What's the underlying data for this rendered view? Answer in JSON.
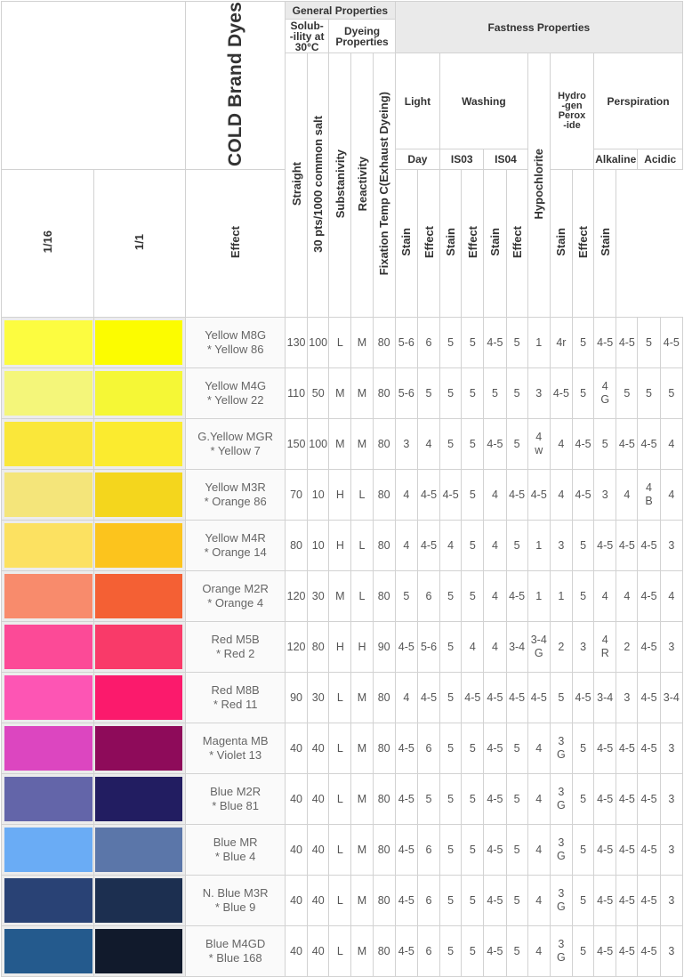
{
  "header": {
    "title": "COLD Brand Dyes",
    "general": "General Properties",
    "solubility": "Solub--ility at 30°C",
    "dyeing": "Dyeing Properties",
    "fastness": "Fastness Properties",
    "light": "Light",
    "day": "Day",
    "washing": "Washing",
    "iso3": "IS03",
    "iso4": "IS04",
    "hydrogen": "Hydro -gen Perox -ide",
    "perspiration": "Perspiration",
    "alkaline": "Alkaline",
    "acidic": "Acidic",
    "cols": {
      "straight": "Straight",
      "salt": "30 pts/1000 common salt",
      "substanivity": "Substanivity",
      "reactivity": "Reactivity",
      "fixation": "Fixation Temp C(Exhaust Dyeing)",
      "l116": "1/16",
      "l11": "1/1",
      "effect": "Effect",
      "stain": "Stain",
      "hypochlorite": "Hypochlorite"
    }
  },
  "colors": {
    "border": "#d2d2d2",
    "header_bg": "#eaeaea"
  },
  "rows": [
    {
      "name": "Yellow M8G",
      "ci": "* Yellow 86",
      "c1": "#fcfc40",
      "c2": "#fcfc00",
      "v": [
        "130",
        "100",
        "L",
        "M",
        "80",
        "5-6",
        "6",
        "5",
        "5",
        "4-5",
        "5",
        "1",
        "4r",
        "5",
        "4-5",
        "4-5",
        "5",
        "4-5"
      ]
    },
    {
      "name": "Yellow M4G",
      "ci": "* Yellow 22",
      "c1": "#f4f67a",
      "c2": "#f5f736",
      "v": [
        "110",
        "50",
        "M",
        "M",
        "80",
        "5-6",
        "5",
        "5",
        "5",
        "5",
        "5",
        "3",
        "4-5",
        "5",
        "4 G",
        "5",
        "5",
        "5"
      ]
    },
    {
      "name": "G.Yellow MGR",
      "ci": "* Yellow 7",
      "c1": "#fae73a",
      "c2": "#fbeb2f",
      "v": [
        "150",
        "100",
        "M",
        "M",
        "80",
        "3",
        "4",
        "5",
        "5",
        "4-5",
        "5",
        "4 w",
        "4",
        "4-5",
        "5",
        "4-5",
        "4-5",
        "4"
      ]
    },
    {
      "name": "Yellow M3R",
      "ci": "* Orange 86",
      "c1": "#f4e57a",
      "c2": "#f4d61d",
      "v": [
        "70",
        "10",
        "H",
        "L",
        "80",
        "4",
        "4-5",
        "4-5",
        "5",
        "4",
        "4-5",
        "4-5",
        "4",
        "4-5",
        "3",
        "4",
        "4 B",
        "4"
      ]
    },
    {
      "name": "Yellow M4R",
      "ci": "* Orange 14",
      "c1": "#fce161",
      "c2": "#fcc41d",
      "v": [
        "80",
        "10",
        "H",
        "L",
        "80",
        "4",
        "4-5",
        "4",
        "5",
        "4",
        "5",
        "1",
        "3",
        "5",
        "4-5",
        "4-5",
        "4-5",
        "3"
      ]
    },
    {
      "name": "Orange M2R",
      "ci": "* Orange 4",
      "c1": "#f88b6c",
      "c2": "#f46034",
      "v": [
        "120",
        "30",
        "M",
        "L",
        "80",
        "5",
        "6",
        "5",
        "5",
        "4",
        "4-5",
        "1",
        "1",
        "5",
        "4",
        "4",
        "4-5",
        "4"
      ]
    },
    {
      "name": "Red M5B",
      "ci": "* Red 2",
      "c1": "#fc4a97",
      "c2": "#f93a69",
      "v": [
        "120",
        "80",
        "H",
        "H",
        "90",
        "4-5",
        "5-6",
        "5",
        "4",
        "4",
        "3-4",
        "3-4 G",
        "2",
        "3",
        "4 R",
        "2",
        "4-5",
        "3"
      ]
    },
    {
      "name": "Red M8B",
      "ci": "* Red 11",
      "c1": "#fd55b4",
      "c2": "#fb1a6c",
      "v": [
        "90",
        "30",
        "L",
        "M",
        "80",
        "4",
        "4-5",
        "5",
        "4-5",
        "4-5",
        "4-5",
        "4-5",
        "5",
        "4-5",
        "3-4",
        "3",
        "4-5",
        "3-4"
      ]
    },
    {
      "name": "Magenta MB",
      "ci": "* Violet 13",
      "c1": "#dc46c0",
      "c2": "#8e0b5a",
      "v": [
        "40",
        "40",
        "L",
        "M",
        "80",
        "4-5",
        "6",
        "5",
        "5",
        "4-5",
        "5",
        "4",
        "3 G",
        "5",
        "4-5",
        "4-5",
        "4-5",
        "3"
      ]
    },
    {
      "name": "Blue M2R",
      "ci": "* Blue 81",
      "c1": "#6365a9",
      "c2": "#221d61",
      "v": [
        "40",
        "40",
        "L",
        "M",
        "80",
        "4-5",
        "5",
        "5",
        "5",
        "4-5",
        "5",
        "4",
        "3 G",
        "5",
        "4-5",
        "4-5",
        "4-5",
        "3"
      ]
    },
    {
      "name": "Blue MR",
      "ci": "* Blue 4",
      "c1": "#6aacf5",
      "c2": "#5b76a9",
      "v": [
        "40",
        "40",
        "L",
        "M",
        "80",
        "4-5",
        "6",
        "5",
        "5",
        "4-5",
        "5",
        "4",
        "3 G",
        "5",
        "4-5",
        "4-5",
        "4-5",
        "3"
      ]
    },
    {
      "name": "N. Blue M3R",
      "ci": "* Blue 9",
      "c1": "#294275",
      "c2": "#1c2f50",
      "v": [
        "40",
        "40",
        "L",
        "M",
        "80",
        "4-5",
        "6",
        "5",
        "5",
        "4-5",
        "5",
        "4",
        "3 G",
        "5",
        "4-5",
        "4-5",
        "4-5",
        "3"
      ]
    },
    {
      "name": "Blue M4GD",
      "ci": "* Blue 168",
      "c1": "#245a8d",
      "c2": "#111a2c",
      "v": [
        "40",
        "40",
        "L",
        "M",
        "80",
        "4-5",
        "6",
        "5",
        "5",
        "4-5",
        "5",
        "4",
        "3 G",
        "5",
        "4-5",
        "4-5",
        "4-5",
        "3"
      ]
    }
  ]
}
